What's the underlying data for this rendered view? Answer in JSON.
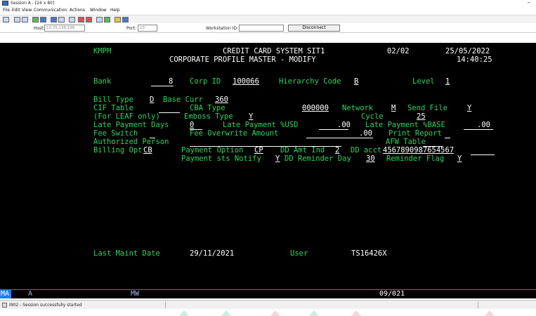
{
  "window": {
    "title": "Session A - [24 x 80]",
    "minimize": "–"
  },
  "menu": [
    "File",
    "Edit",
    "View",
    "Communication",
    "Actions",
    "Window",
    "Help"
  ],
  "connection": {
    "host_label": "Host:",
    "host_value": "10.25.138.198",
    "port_label": "Port:",
    "port_value": "23",
    "workstation_label": "Workstation ID:",
    "workstation_value": "",
    "disconnect_label": "Disconnect"
  },
  "screen": {
    "header": {
      "program": "KMPM",
      "system": "CREDIT CARD SYSTEM SIT1",
      "page": "02/02",
      "date": "25/05/2022",
      "title": "CORPORATE PROFILE MASTER - MODIFY",
      "time": "14:40:25"
    },
    "bank_label": "Bank",
    "bank_value": "8",
    "corp_label": "Corp ID",
    "corp_value": "100066",
    "hier_label": "Hierarchy Code",
    "hier_value": "B",
    "level_label": "Level",
    "level_value": "1",
    "bill_type_label": "Bill Type",
    "bill_type_value": "D",
    "base_curr_label": "Base Curr",
    "base_curr_value": "360",
    "cif_label": "CIF Table",
    "cif_value": "",
    "cba_label": "CBA Type",
    "cba_value": "000000",
    "network_label": "Network",
    "network_value": "M",
    "send_file_label": "Send File",
    "send_file_value": "Y",
    "leaf_label": "(For LEAF only)",
    "emboss_label": "Emboss Type",
    "emboss_value": "Y",
    "cycle_label": "Cycle",
    "cycle_value": "25",
    "late_days_label": "Late Payment Days",
    "late_days_value": "0",
    "late_usd_label": "Late Payment %USD",
    "late_usd_value": ".00",
    "late_base_label": "Late Payment %BASE",
    "late_base_value": ".00",
    "fee_switch_label": "Fee Switch",
    "fee_switch_value": "",
    "fee_overwrite_label": "Fee Overwrite Amount",
    "fee_overwrite_value": ".00",
    "print_report_label": "Print Report",
    "print_report_value": "",
    "auth_label": "Authorized Person",
    "auth_value": "",
    "afw_label": "AFW Table",
    "afw_value": "",
    "billing_opt_label": "Billing Opt",
    "billing_opt_value": "CB",
    "pay_opt_label": "Payment Option",
    "pay_opt_value": "CP",
    "dd_amt_label": "DD Amt Ind",
    "dd_amt_value": "2",
    "dd_acct_label": "DD acct",
    "dd_acct_value": "4567890987654567",
    "pay_notify_label": "Payment sts Notify",
    "pay_notify_value": "Y",
    "dd_reminder_label": "DD Reminder Day",
    "dd_reminder_value": "30",
    "reminder_flag_label": "Reminder Flag",
    "reminder_flag_value": "Y",
    "last_maint_label": "Last Maint Date",
    "last_maint_value": "29/11/2021",
    "user_label": "User",
    "user_value": "TS16426X"
  },
  "oia": {
    "block": "MA",
    "session": "A",
    "mode": "MW",
    "cursor": "09/021"
  },
  "status": {
    "message": "I902 - Session successfully started"
  },
  "colors": {
    "terminal_bg": "#000000",
    "field_text": "#2bd45c",
    "value_text": "#ffffff",
    "oia_accent": "#1a7fff"
  }
}
